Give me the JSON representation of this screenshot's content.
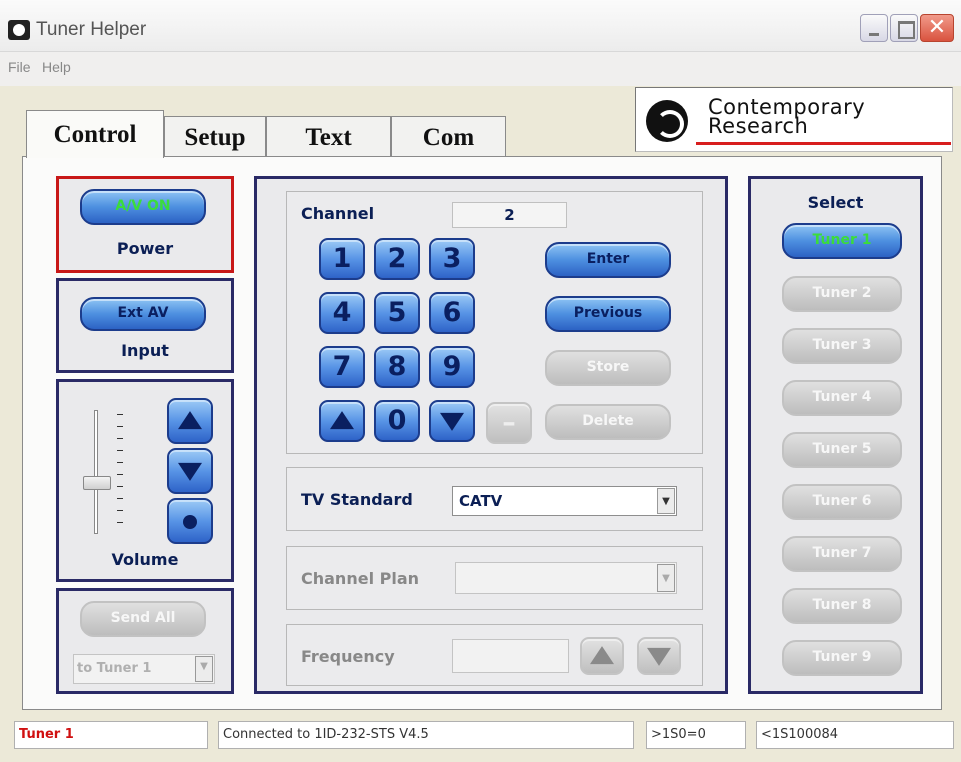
{
  "window": {
    "title": "Tuner Helper",
    "close_glyph": "✕",
    "icon": "app-icon"
  },
  "menu": {
    "file": "File",
    "help": "Help"
  },
  "logo": {
    "line1": "Contemporary",
    "line2": "Research"
  },
  "tabs": [
    {
      "label": "Control",
      "active": true
    },
    {
      "label": "Setup"
    },
    {
      "label": "Text"
    },
    {
      "label": "Com"
    }
  ],
  "power": {
    "button": "A/V ON",
    "label": "Power"
  },
  "input": {
    "button": "Ext AV",
    "label": "Input"
  },
  "volume": {
    "label": "Volume",
    "level_percent": 40
  },
  "send": {
    "button": "Send All",
    "target": "to Tuner 1"
  },
  "channel": {
    "label": "Channel",
    "value": "2",
    "keys": [
      "1",
      "2",
      "3",
      "4",
      "5",
      "6",
      "7",
      "8",
      "9",
      "0"
    ],
    "dash": "–",
    "enter": "Enter",
    "previous": "Previous",
    "store": "Store",
    "delete": "Delete"
  },
  "tv_standard": {
    "label": "TV Standard",
    "value": "CATV"
  },
  "channel_plan": {
    "label": "Channel Plan",
    "value": ""
  },
  "frequency": {
    "label": "Frequency",
    "value": ""
  },
  "select": {
    "label": "Select",
    "tuners": [
      "Tuner 1",
      "Tuner 2",
      "Tuner 3",
      "Tuner 4",
      "Tuner 5",
      "Tuner 6",
      "Tuner 7",
      "Tuner 8",
      "Tuner 9"
    ],
    "active_index": 0
  },
  "status": {
    "tuner": "Tuner 1",
    "connection": "Connected to 1ID-232-STS V4.5",
    "tx": ">1S0=0",
    "rx": "<1S100084"
  },
  "colors": {
    "accent": "#2c62c4",
    "frame": "#2a2a66",
    "power_frame": "#c81818",
    "active_text": "#3bdc3b",
    "status_red": "#d01010"
  }
}
